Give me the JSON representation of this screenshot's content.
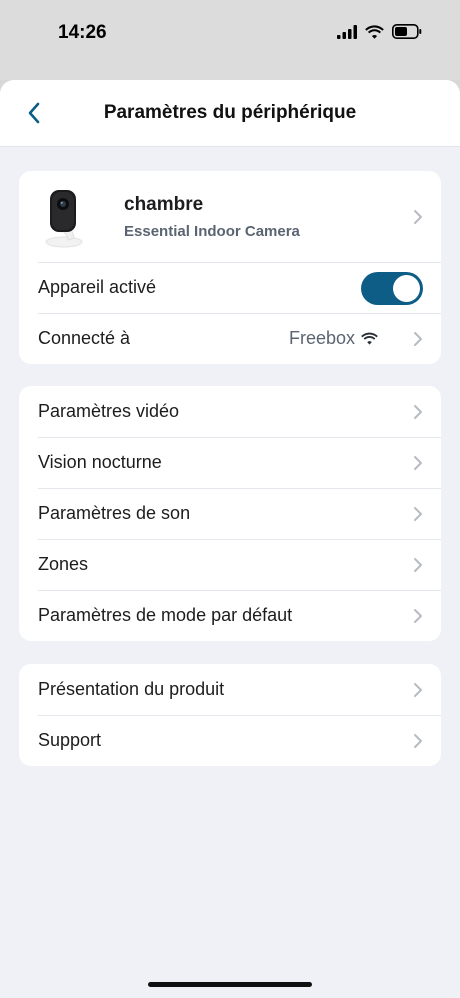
{
  "status_bar": {
    "time": "14:26"
  },
  "nav": {
    "title": "Paramètres du périphérique"
  },
  "device": {
    "name": "chambre",
    "model": "Essential Indoor Camera",
    "enabled_label": "Appareil activé",
    "enabled": true,
    "connected_label": "Connecté à",
    "network": "Freebox"
  },
  "settings": [
    "Paramètres vidéo",
    "Vision nocturne",
    "Paramètres de son",
    "Zones",
    "Paramètres de mode par défaut"
  ],
  "info": [
    "Présentation du produit",
    "Support"
  ],
  "colors": {
    "accent": "#0e5d86",
    "background": "#eff1f6",
    "secondary_text": "#5b6572"
  }
}
